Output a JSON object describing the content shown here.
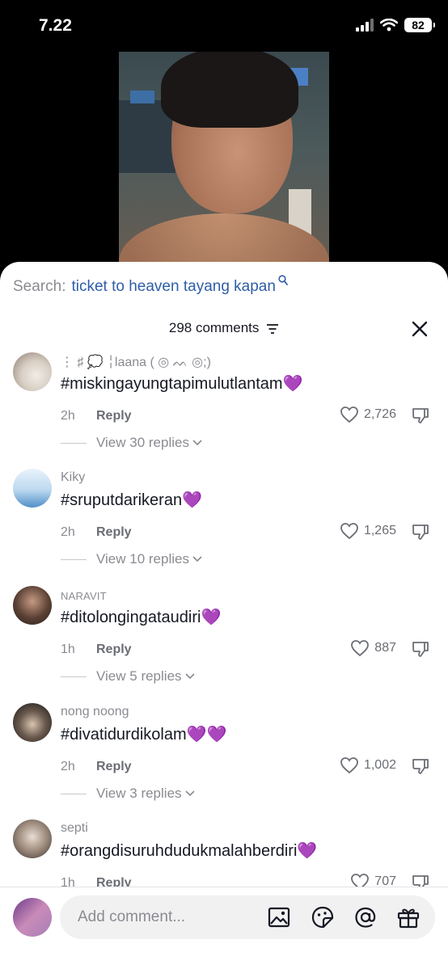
{
  "status_bar": {
    "time": "7.22",
    "battery": "82"
  },
  "search": {
    "label": "Search:",
    "term": "ticket to heaven tayang kapan"
  },
  "header": {
    "comments_count": "298 comments"
  },
  "comments": [
    {
      "user": "⋮ ♯ 💭 ╎laana ( ◎ ᨓ ◎;)",
      "text": "#miskingayungtapimulutlantam",
      "emoji": "💜",
      "time": "2h",
      "reply": "Reply",
      "likes": "2,726",
      "replies": "View 30 replies"
    },
    {
      "user": "Kiky",
      "text": "#sruputdarikeran",
      "emoji": "💜",
      "time": "2h",
      "reply": "Reply",
      "likes": "1,265",
      "replies": "View 10 replies"
    },
    {
      "user": "NARAVIT",
      "text": "#ditolongingataudiri",
      "emoji": "💜",
      "time": "1h",
      "reply": "Reply",
      "likes": "887",
      "replies": "View 5 replies"
    },
    {
      "user": "nong noong",
      "text": "#divatidurdikolam",
      "emoji": "💜💜",
      "time": "2h",
      "reply": "Reply",
      "likes": "1,002",
      "replies": "View 3 replies"
    },
    {
      "user": "septi",
      "text": "#orangdisuruhdudukmalahberdiri",
      "emoji": "💜",
      "time": "1h",
      "reply": "Reply",
      "likes": "707",
      "replies": ""
    }
  ],
  "composer": {
    "placeholder": "Add comment..."
  },
  "colors": {
    "accent_blue": "#2e5ea8",
    "heart_purple": "#9b3fe0",
    "text_primary": "#161823",
    "text_secondary": "#8a8b91"
  },
  "icons": [
    "signal-icon",
    "wifi-icon",
    "battery-icon",
    "search-icon",
    "filter-icon",
    "close-icon",
    "heart-icon",
    "dislike-icon",
    "chevron-down-icon",
    "image-icon",
    "sticker-icon",
    "mention-icon",
    "gift-icon"
  ]
}
